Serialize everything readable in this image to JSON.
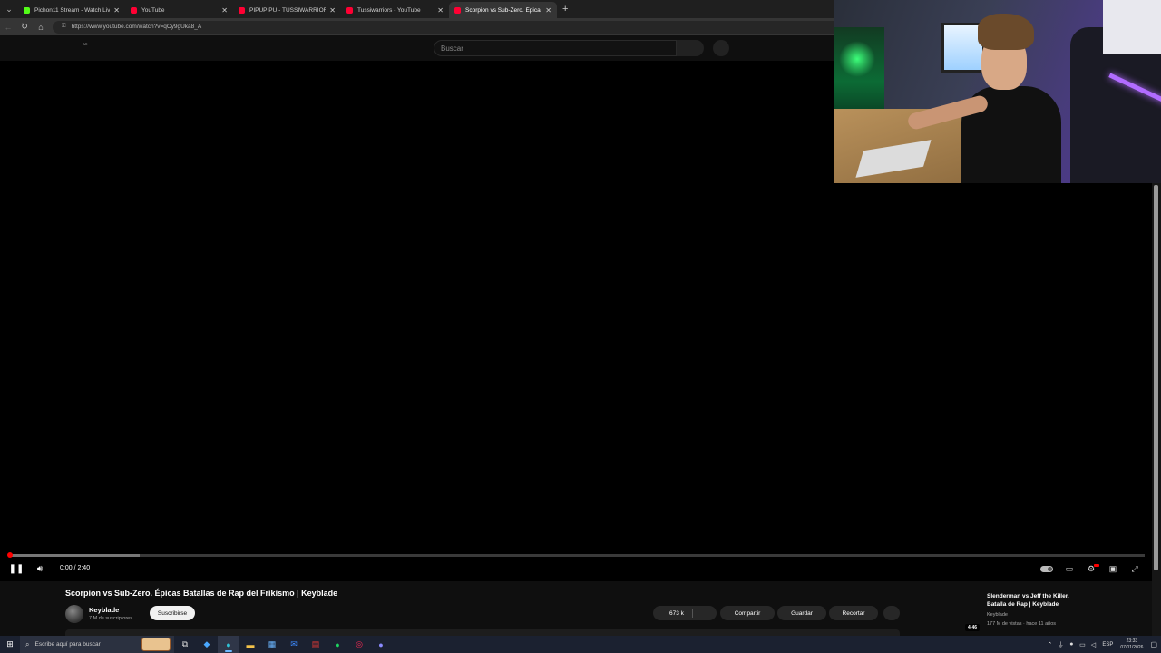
{
  "browser": {
    "tabs": [
      {
        "label": "Pichon11 Stream - Watch Live on",
        "favicon_color": "#53fc18",
        "active": false
      },
      {
        "label": "YouTube",
        "favicon_color": "#ff0033",
        "active": false
      },
      {
        "label": "PIPUPIPU - TUSSIWARRIORS (VIDE",
        "favicon_color": "#ff0033",
        "active": false
      },
      {
        "label": "Tussiwarriors - YouTube",
        "favicon_color": "#ff0033",
        "active": false
      },
      {
        "label": "Scorpion vs Sub-Zero. Épicas",
        "favicon_color": "#ff0033",
        "active": true
      }
    ],
    "url": "https://www.youtube.com/watch?v=qCy9gUka8_A"
  },
  "youtube": {
    "country_code": "AR",
    "search_placeholder": "Buscar",
    "player": {
      "time_display": "0:00 / 2:40",
      "progress_fraction": 0.0,
      "buffered_fraction": 0.115
    },
    "video": {
      "title": "Scorpion vs Sub-Zero. Épicas Batallas de Rap del Frikismo | Keyblade",
      "channel": "Keyblade",
      "subscribers": "7 M de suscriptores",
      "subscribe_label": "Suscribirse",
      "likes": "673 k",
      "share_label": "Compartir",
      "save_label": "Guardar",
      "clip_label": "Recortar"
    },
    "recommended": {
      "title": "Slenderman vs Jeff the Killer. Batalla de Rap | Keyblade",
      "channel": "Keyblade",
      "meta": "177 M de vistas · hace 11 años",
      "duration": "4:46"
    }
  },
  "taskbar": {
    "search_placeholder": "Escribe aquí para buscar",
    "apps": [
      "task-view",
      "copilot",
      "edge",
      "file-explorer",
      "store",
      "mail",
      "news",
      "spotify",
      "opera-gx",
      "discord"
    ],
    "language": "ESP",
    "time": "23:33",
    "date": "07/01/2026"
  },
  "colors": {
    "accent_red": "#ff0000",
    "yt_background": "#0f0f0f",
    "pill_background": "#272727"
  }
}
